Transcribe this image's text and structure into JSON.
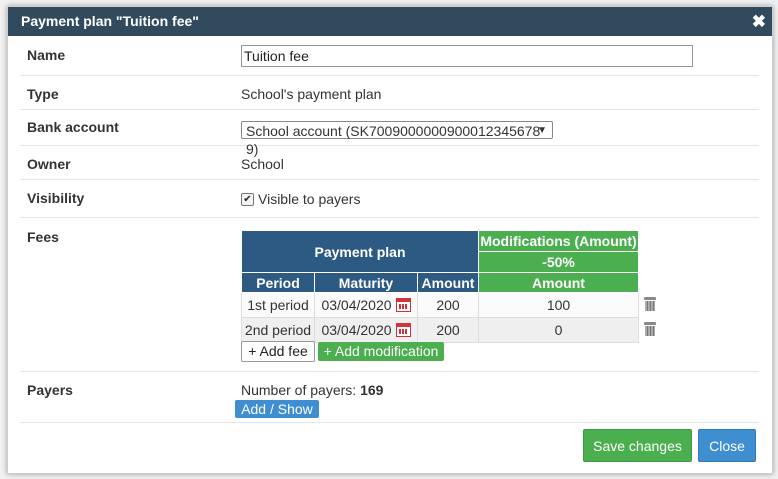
{
  "dialog": {
    "title": "Payment plan \"Tuition fee\"",
    "close_glyph": "✖"
  },
  "fields": {
    "name": {
      "label": "Name",
      "value": "Tuition fee"
    },
    "type": {
      "label": "Type",
      "value": "School's payment plan"
    },
    "bank_account": {
      "label": "Bank account",
      "selected": "School account (SK7009000000900012345678​9)"
    },
    "owner": {
      "label": "Owner",
      "value": "School"
    },
    "visibility": {
      "label": "Visibility",
      "checkbox_label": "Visible to payers",
      "checked": true
    },
    "fees": {
      "label": "Fees"
    },
    "payers": {
      "label": "Payers",
      "count_label": "Number of payers:",
      "count": "169"
    }
  },
  "fees_table": {
    "plan_header": "Payment plan",
    "mods_header": "Modifications (Amount)",
    "mods_pct": "-50%",
    "columns": [
      "Period",
      "Maturity",
      "Amount",
      "Amount"
    ],
    "rows": [
      {
        "period": "1st period",
        "maturity": "03/04/2020",
        "amount": "200",
        "mod_amount": "100"
      },
      {
        "period": "2nd period",
        "maturity": "03/04/2020",
        "amount": "200",
        "mod_amount": "0"
      }
    ]
  },
  "buttons": {
    "add_fee": "+ Add fee",
    "add_modification": "+ Add modification",
    "add_show": "Add / Show",
    "save": "Save changes",
    "close": "Close"
  },
  "colors": {
    "titlebar": "#324a5e",
    "plan_header": "#2d5a82",
    "mods_header": "#4bae4f",
    "primary_blue": "#3e8ed0",
    "success_green": "#4bae4f"
  },
  "icons": {
    "calendar": "calendar-icon",
    "trash": "trash-icon",
    "close": "close-icon"
  }
}
